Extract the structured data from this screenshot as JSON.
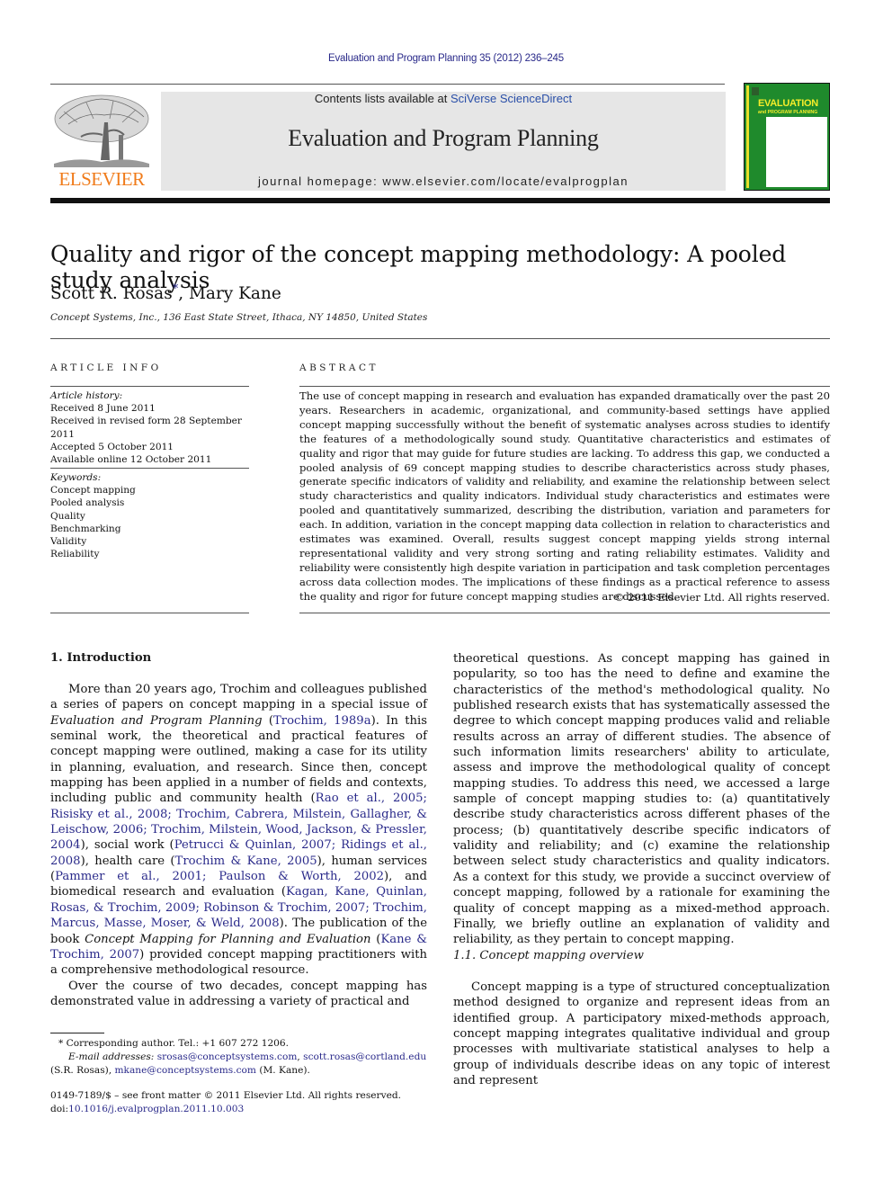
{
  "header": {
    "journal_ref": "Evaluation and Program Planning 35 (2012) 236–245",
    "contents_prefix": "Contents lists available at ",
    "contents_link": "SciVerse ScienceDirect",
    "journal_title": "Evaluation and Program Planning",
    "homepage": "journal homepage: www.elsevier.com/locate/evalprogplan",
    "publisher_logo": "ELSEVIER",
    "cover": {
      "title_line1": "EVALUATION",
      "title_line2": "and PROGRAM PLANNING",
      "colors": {
        "background": "#1f8a2c",
        "title": "#f4ec2a"
      }
    },
    "colors": {
      "publisher_orange": "#f07b1a",
      "link_blue": "#2a2a8a"
    }
  },
  "article": {
    "title": "Quality and rigor of the concept mapping methodology: A pooled study analysis",
    "authors": [
      {
        "name": "Scott R. Rosas",
        "mark": "*"
      },
      {
        "name": "Mary Kane",
        "mark": ""
      }
    ],
    "author_separator": ", ",
    "affiliation": "Concept Systems, Inc., 136 East State Street, Ithaca, NY 14850, United States"
  },
  "article_info": {
    "heading": "ARTICLE INFO",
    "history_label": "Article history:",
    "history": [
      "Received 8 June 2011",
      "Received in revised form 28 September 2011",
      "Accepted 5 October 2011",
      "Available online 12 October 2011"
    ],
    "keywords_label": "Keywords:",
    "keywords": [
      "Concept mapping",
      "Pooled analysis",
      "Quality",
      "Benchmarking",
      "Validity",
      "Reliability"
    ]
  },
  "abstract": {
    "heading": "ABSTRACT",
    "text": "The use of concept mapping in research and evaluation has expanded dramatically over the past 20 years. Researchers in academic, organizational, and community-based settings have applied concept mapping successfully without the benefit of systematic analyses across studies to identify the features of a methodologically sound study. Quantitative characteristics and estimates of quality and rigor that may guide for future studies are lacking. To address this gap, we conducted a pooled analysis of 69 concept mapping studies to describe characteristics across study phases, generate specific indicators of validity and reliability, and examine the relationship between select study characteristics and quality indicators. Individual study characteristics and estimates were pooled and quantitatively summarized, describing the distribution, variation and parameters for each. In addition, variation in the concept mapping data collection in relation to characteristics and estimates was examined. Overall, results suggest concept mapping yields strong internal representational validity and very strong sorting and rating reliability estimates. Validity and reliability were consistently high despite variation in participation and task completion percentages across data collection modes. The implications of these findings as a practical reference to assess the quality and rigor for future concept mapping studies are discussed.",
    "copyright": "© 2011 Elsevier Ltd. All rights reserved."
  },
  "body": {
    "section1_heading": "1.  Introduction",
    "p1": {
      "t1": "More than 20 years ago, Trochim and colleagues published a series of papers on concept mapping in a special issue of ",
      "i1": "Evaluation and Program Planning",
      "t2": " (",
      "c1": "Trochim, 1989a",
      "t3": "). In this seminal work, the theoretical and practical features of concept mapping were outlined, making a case for its utility in planning, evaluation, and research. Since then, concept mapping has been applied in a number of fields and contexts, including public and community health (",
      "c2": "Rao et al., 2005; Risisky et al., 2008; Trochim, Cabrera, Milstein, Gallagher, & Leischow, 2006; Trochim, Milstein, Wood, Jackson, & Pressler, 2004",
      "t4": "), social work (",
      "c3": "Petrucci & Quinlan, 2007; Ridings et al., 2008",
      "t5": "), health care (",
      "c4": "Trochim & Kane, 2005",
      "t6": "), human services (",
      "c5": "Pammer et al., 2001; Paulson & Worth, 2002",
      "t7": "), and biomedical research and evaluation (",
      "c6": "Kagan, Kane, Quinlan, Rosas, & Trochim, 2009; Robinson & Trochim, 2007; Trochim, Marcus, Masse, Moser, & Weld, 2008",
      "t8": "). The publication of the book ",
      "i2": "Concept Mapping for Planning and Evaluation",
      "t9": " (",
      "c7": "Kane & Trochim, 2007",
      "t10": ") provided concept mapping practitioners with a comprehensive methodological resource."
    },
    "p2_left": "Over the course of two decades, concept mapping has demonstrated value in addressing a variety of practical and",
    "p2_right": "theoretical questions. As concept mapping has gained in popularity, so too has the need to define and examine the characteristics of the method's methodological quality. No published research exists that has systematically assessed the degree to which concept mapping produces valid and reliable results across an array of different studies. The absence of such information limits researchers' ability to articulate, assess and improve the methodological quality of concept mapping studies. To address this need, we accessed a large sample of concept mapping studies to: (a) quantitatively describe study characteristics across different phases of the process; (b) quantitatively describe specific indicators of validity and reliability; and (c) examine the relationship between select study characteristics and quality indicators. As a context for this study, we provide a succinct overview of concept mapping, followed by a rationale for examining the quality of concept mapping as a mixed-method approach. Finally, we briefly outline an explanation of validity and reliability, as they pertain to concept mapping.",
    "subsection_heading": "1.1.  Concept mapping overview",
    "p3": "Concept mapping is a type of structured conceptualization method designed to organize and represent ideas from an identified group. A participatory mixed-methods approach, concept mapping integrates qualitative individual and group processes with multivariate statistical analyses to help a group of individuals describe ideas on any topic of interest and represent"
  },
  "footnotes": {
    "mark": "*",
    "corresponding": " Corresponding author. Tel.: +1 607 272 1206.",
    "email_label": "E-mail addresses:",
    "email1": "srosas@conceptsystems.com",
    "email_sep": ", ",
    "email2": "scott.rosas@cortland.edu",
    "email_owner1": "(S.R. Rosas), ",
    "email3": "mkane@conceptsystems.com",
    "email_owner2": " (M. Kane)."
  },
  "front_matter": {
    "issn_line": "0149-7189/$ – see front matter © 2011 Elsevier Ltd. All rights reserved.",
    "doi_prefix": "doi:",
    "doi": "10.1016/j.evalprogplan.2011.10.003"
  }
}
